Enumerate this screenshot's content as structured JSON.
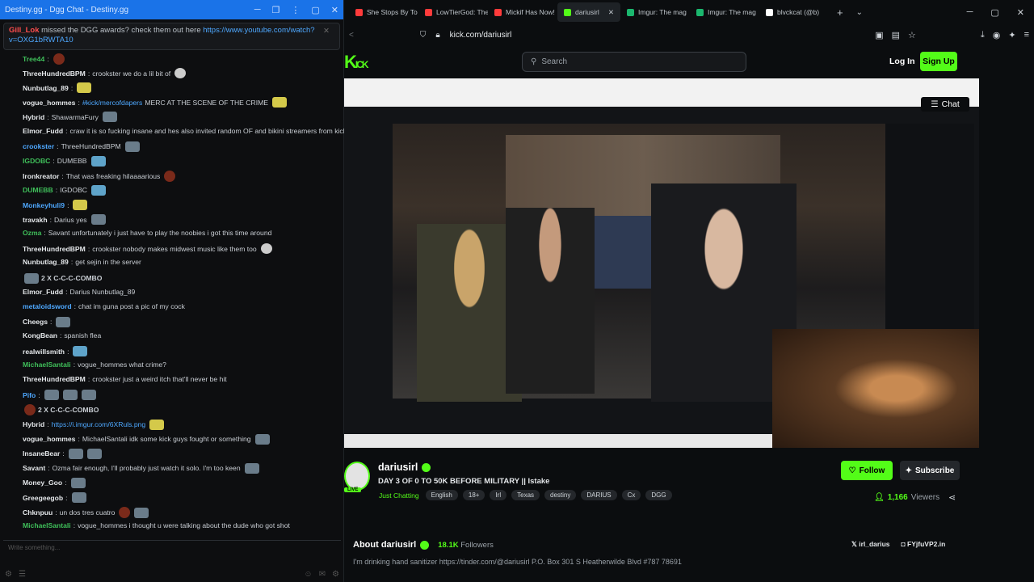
{
  "left_window": {
    "title": "Destiny.gg - Dgg Chat - Destiny.gg",
    "pinned_nick": "Gill_Lok",
    "pinned_text": "missed the DGG awards? check them out here",
    "pinned_link": "https://www.youtube.com/watch?v=OXG1bRWTA10",
    "input_placeholder": "Write something...",
    "messages": [
      {
        "nick": "Tree44",
        "color": "#3fbf5a",
        "text": "",
        "emotes": [
          "r"
        ]
      },
      {
        "nick": "ThreeHundredBPM",
        "color": "#e4e7ea",
        "text": "crookster we do a lil bit of",
        "emotes": [
          "w"
        ]
      },
      {
        "nick": "Nunbutlag_89",
        "color": "#e4e7ea",
        "text": "",
        "emotes": [
          "y"
        ]
      },
      {
        "nick": "vogue_hommes",
        "color": "#e4e7ea",
        "text": "MERC AT THE SCENE OF THE CRIME",
        "link": "#kick/mercofdapers",
        "emotes": [
          "y"
        ]
      },
      {
        "nick": "Hybrid",
        "color": "#e4e7ea",
        "text": "ShawarmaFury",
        "emotes": [
          "g"
        ]
      },
      {
        "nick": "Elmor_Fudd",
        "color": "#e4e7ea",
        "text": "craw it is so fucking insane and hes also invited random OF and bikini streamers from kick",
        "emotes": []
      },
      {
        "nick": "crookster",
        "color": "#4ea8ff",
        "text": "ThreeHundredBPM",
        "emotes": [
          "g"
        ]
      },
      {
        "nick": "IGDOBC",
        "color": "#3fbf5a",
        "text": "DUMEBB",
        "emotes": [
          "b"
        ]
      },
      {
        "nick": "Ironkreator",
        "color": "#e4e7ea",
        "text": "That was freaking hilaaaarious",
        "emotes": [
          "r"
        ]
      },
      {
        "nick": "DUMEBB",
        "color": "#3fbf5a",
        "text": "IGDOBC",
        "emotes": [
          "b"
        ]
      },
      {
        "nick": "Monkeyhuli9",
        "color": "#4ea8ff",
        "text": "",
        "emotes": [
          "y"
        ]
      },
      {
        "nick": "travakh",
        "color": "#e4e7ea",
        "text": "Darius yes",
        "emotes": [
          "g"
        ]
      },
      {
        "nick": "Ozma",
        "color": "#3fbf5a",
        "text": "Savant unfortunately i just have to play the noobies i got this time around",
        "emotes": []
      },
      {
        "nick": "ThreeHundredBPM",
        "color": "#e4e7ea",
        "text": "crookster   nobody makes midwest music like them too",
        "emotes": [
          "w"
        ]
      },
      {
        "nick": "Nunbutlag_89",
        "color": "#e4e7ea",
        "text": "get sejin in the server",
        "emotes": []
      },
      {
        "nick": "",
        "color": "#e4e7ea",
        "text": "2 X C-C-C-COMBO",
        "emotes": [
          "g"
        ],
        "combo": true
      },
      {
        "nick": "Elmor_Fudd",
        "color": "#e4e7ea",
        "text": "Darius   Nunbutlag_89",
        "emotes": []
      },
      {
        "nick": "metaloidsword",
        "color": "#4ea8ff",
        "text": "chat im guna post a pic of my cock",
        "emotes": []
      },
      {
        "nick": "Cheegs",
        "color": "#e4e7ea",
        "text": "",
        "emotes": [
          "g"
        ]
      },
      {
        "nick": "KongBean",
        "color": "#e4e7ea",
        "text": "spanish flea",
        "emotes": []
      },
      {
        "nick": "realwillsmith",
        "color": "#e4e7ea",
        "text": "",
        "emotes": [
          "b"
        ]
      },
      {
        "nick": "MichaelSantali",
        "color": "#3fbf5a",
        "text": "vogue_hommes what crime?",
        "emotes": []
      },
      {
        "nick": "ThreeHundredBPM",
        "color": "#e4e7ea",
        "text": "crookster just a weird itch that'll never be hit",
        "emotes": []
      },
      {
        "nick": "Pifo",
        "color": "#4ea8ff",
        "text": "",
        "emotes": [
          "g",
          "g",
          "g"
        ]
      },
      {
        "nick": "",
        "color": "#e4e7ea",
        "text": "2 X C-C-C-COMBO",
        "emotes": [
          "r"
        ],
        "combo": true
      },
      {
        "nick": "Hybrid",
        "color": "#e4e7ea",
        "text": "",
        "link": "https://i.imgur.com/6XRuls.png",
        "emotes": [
          "y"
        ]
      },
      {
        "nick": "vogue_hommes",
        "color": "#e4e7ea",
        "text": "MichaelSantali idk some kick guys fought or something",
        "emotes": [
          "g"
        ]
      },
      {
        "nick": "InsaneBear",
        "color": "#e4e7ea",
        "text": "",
        "emotes": [
          "g",
          "g"
        ]
      },
      {
        "nick": "Savant",
        "color": "#e4e7ea",
        "text": "Ozma fair enough, I'll probably just watch it solo. I'm too keen",
        "emotes": [
          "g"
        ]
      },
      {
        "nick": "Money_Goo",
        "color": "#e4e7ea",
        "text": "",
        "emotes": [
          "g"
        ]
      },
      {
        "nick": "Greegeegob",
        "color": "#e4e7ea",
        "text": "",
        "emotes": [
          "g"
        ]
      },
      {
        "nick": "Chknpuu",
        "color": "#e4e7ea",
        "text": "un dos tres cuatro",
        "emotes": [
          "r",
          "g"
        ]
      },
      {
        "nick": "MichaelSantali",
        "color": "#3fbf5a",
        "text": "vogue_hommes i thought u were talking about the dude who got shot",
        "emotes": []
      }
    ]
  },
  "browser": {
    "tabs": [
      {
        "label": "She Stops By To",
        "color": "#ff3b3b"
      },
      {
        "label": "LowTierGod: The",
        "color": "#ff3b3b"
      },
      {
        "label": "Mickif Has Now!",
        "color": "#ff3b3b"
      },
      {
        "label": "dariusirl",
        "color": "#53fc18",
        "active": true
      },
      {
        "label": "Imgur: The mag",
        "color": "#1bb76e"
      },
      {
        "label": "Imgur: The mag",
        "color": "#1bb76e"
      },
      {
        "label": "blvckcat (@b)",
        "color": "#ffffff"
      }
    ],
    "url": "kick.com/dariusirl"
  },
  "kick": {
    "logo": "K",
    "search_placeholder": "Search",
    "login": "Log In",
    "signup": "Sign Up",
    "chat_button": "Chat"
  },
  "stream": {
    "channel": "dariusirl",
    "title": "DAY 3 OF 0 TO 50K BEFORE MILITARY || Istake",
    "category": "Just Chatting",
    "tags": [
      "English",
      "18+",
      "Irl",
      "Texas",
      "destiny",
      "DARIUS",
      "Cx",
      "DGG"
    ],
    "follow": "Follow",
    "subscribe": "Subscribe",
    "viewers_count": "1,166",
    "viewers_label": "Viewers",
    "live_badge": "LIVE"
  },
  "about": {
    "heading": "About dariusirl",
    "followers_count": "18.1K",
    "followers_label": "Followers",
    "bio": "I'm drinking hand sanitizer https://tinder.com/@dariusirl P.O. Box 301 S Heatherwilde Blvd #787 78691",
    "x_handle": "irl_darius",
    "discord": "FYjfuVP2.in"
  }
}
